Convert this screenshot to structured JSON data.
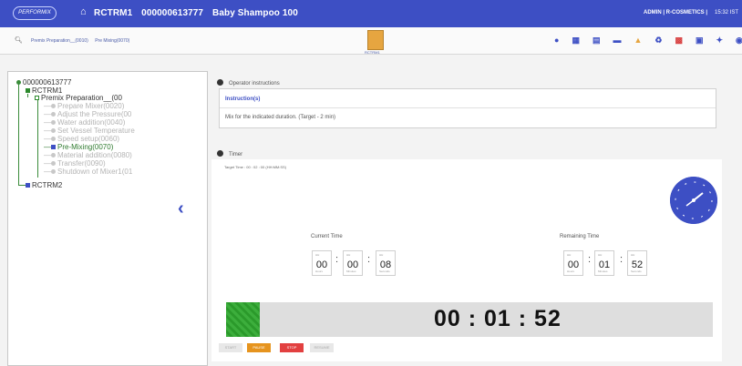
{
  "header": {
    "logo": "PERFORMIX",
    "title_parts": [
      "RCTRM1",
      "000000613777",
      "Baby Shampoo 100"
    ],
    "user": "ADMIN | R-COSMETICS |",
    "time": "15:32 IST"
  },
  "subbar": {
    "crumb_1": "Premix Preparation__(0010)",
    "crumb_2": "Pre Mixing(0070)",
    "center_button_label": "RCTRM1",
    "toolbar_icons": [
      "start-icon",
      "sidebar-icon",
      "document-icon",
      "card-icon",
      "warning-icon",
      "person-icon",
      "pdf-icon",
      "copy-icon",
      "pin-icon",
      "info-icon"
    ]
  },
  "tree": {
    "order": "000000613777",
    "unit_1": "RCTRM1",
    "phase": "Premix Preparation__(00",
    "steps": [
      "Prepare Mixer(0020)",
      "Adjust the Pressure(00",
      "Water addition(0040)",
      "Set Vessel Temperature",
      "Speed setup(0060)",
      "Pre-Mixing(0070)",
      "Material addition(0080)",
      "Transfer(0090)",
      "Shutdown of Mixer1(01"
    ],
    "active_step_index": 5,
    "unit_2": "RCTRM2"
  },
  "operator": {
    "section_label": "Operator instructions",
    "instr_title": "Instruction(s)",
    "instr_text": "Mix for the indicated duration. (Target - 2 min)"
  },
  "timer": {
    "section_label": "Timer",
    "target": "Target Time : 00 : 02 : 00 (HH:MM:SS)",
    "current_label": "Current Time",
    "remaining_label": "Remaining Time",
    "unit_top": "HH",
    "unit_labels": [
      "Hours",
      "Minutes",
      "Seconds"
    ],
    "current": [
      "00",
      "00",
      "08"
    ],
    "remaining": [
      "00",
      "01",
      "52"
    ],
    "big": "00 : 01 : 52",
    "progress_fraction": 0.07
  },
  "buttons": {
    "start": "START",
    "pause": "PAUSE",
    "stop": "STOP",
    "resume": "RESUME"
  },
  "colors": {
    "primary": "#3d4fc4",
    "progress_green": "#3cae3c",
    "pause": "#e6941e",
    "stop": "#e24040"
  }
}
